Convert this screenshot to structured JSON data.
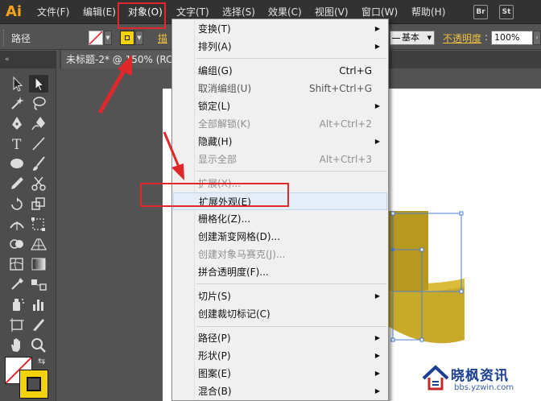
{
  "app": {
    "logo": "Ai"
  },
  "menubar": {
    "items": [
      {
        "label": "文件(F)"
      },
      {
        "label": "编辑(E)"
      },
      {
        "label": "对象(O)"
      },
      {
        "label": "文字(T)"
      },
      {
        "label": "选择(S)"
      },
      {
        "label": "效果(C)"
      },
      {
        "label": "视图(V)"
      },
      {
        "label": "窗口(W)"
      },
      {
        "label": "帮助(H)"
      }
    ],
    "right_buttons": [
      {
        "label": "Br"
      },
      {
        "label": "St"
      }
    ]
  },
  "controlbar": {
    "selection_label": "路径",
    "stroke_label": "描",
    "brush_label": "基本",
    "opacity_label": "不透明度",
    "opacity_value": "100%"
  },
  "document": {
    "tab_label": "未标题-2* @ 150% (RC"
  },
  "object_menu": {
    "items": [
      {
        "label": "变换(T)",
        "shortcut": "",
        "submenu": true,
        "disabled": false
      },
      {
        "label": "排列(A)",
        "shortcut": "",
        "submenu": true,
        "disabled": false
      },
      {
        "label": "编组(G)",
        "shortcut": "Ctrl+G",
        "submenu": false,
        "disabled": false
      },
      {
        "label": "取消编组(U)",
        "shortcut": "Shift+Ctrl+G",
        "submenu": false,
        "disabled": false
      },
      {
        "label": "锁定(L)",
        "shortcut": "",
        "submenu": true,
        "disabled": false
      },
      {
        "label": "全部解锁(K)",
        "shortcut": "Alt+Ctrl+2",
        "submenu": false,
        "disabled": true
      },
      {
        "label": "隐藏(H)",
        "shortcut": "",
        "submenu": true,
        "disabled": false
      },
      {
        "label": "显示全部",
        "shortcut": "Alt+Ctrl+3",
        "submenu": false,
        "disabled": true
      },
      {
        "label": "扩展(X)...",
        "shortcut": "",
        "submenu": false,
        "disabled": true
      },
      {
        "label": "扩展外观(E)",
        "shortcut": "",
        "submenu": false,
        "disabled": false,
        "highlighted": true
      },
      {
        "label": "栅格化(Z)...",
        "shortcut": "",
        "submenu": false,
        "disabled": false
      },
      {
        "label": "创建渐变网格(D)...",
        "shortcut": "",
        "submenu": false,
        "disabled": false
      },
      {
        "label": "创建对象马赛克(J)...",
        "shortcut": "",
        "submenu": false,
        "disabled": true
      },
      {
        "label": "拼合透明度(F)...",
        "shortcut": "",
        "submenu": false,
        "disabled": false
      },
      {
        "label": "切片(S)",
        "shortcut": "",
        "submenu": true,
        "disabled": false
      },
      {
        "label": "创建裁切标记(C)",
        "shortcut": "",
        "submenu": false,
        "disabled": false
      },
      {
        "label": "路径(P)",
        "shortcut": "",
        "submenu": true,
        "disabled": false
      },
      {
        "label": "形状(P)",
        "shortcut": "",
        "submenu": true,
        "disabled": false
      },
      {
        "label": "图案(E)",
        "shortcut": "",
        "submenu": true,
        "disabled": false
      },
      {
        "label": "混合(B)",
        "shortcut": "",
        "submenu": true,
        "disabled": false
      }
    ]
  },
  "watermark": {
    "title": "晓枫资讯",
    "url": "bbs.yzwin.com"
  },
  "colors": {
    "menubar_bg": "#323232",
    "panel_bg": "#535353",
    "menu_bg": "#f0f0f0",
    "highlight_row": "#e5eef8",
    "annotation_red": "#e0272a",
    "object_gold": "#c9a92a",
    "logo_orange": "#f7a21b"
  }
}
